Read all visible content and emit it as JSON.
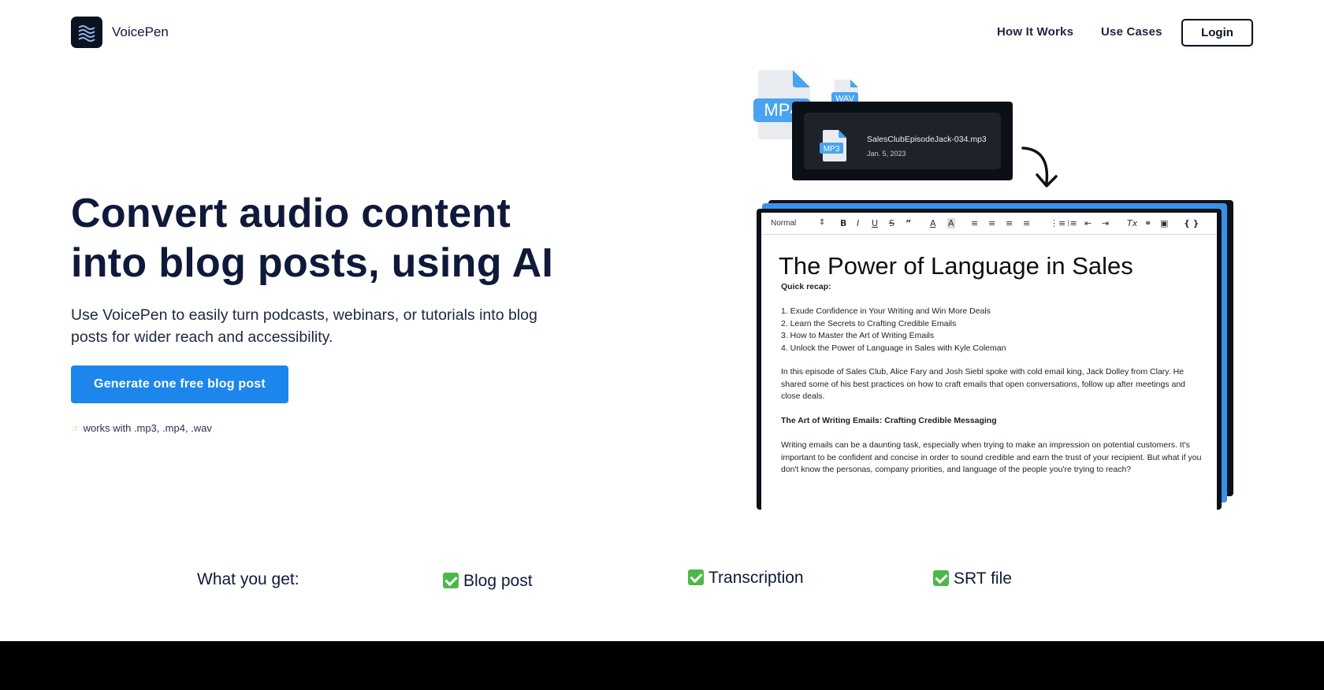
{
  "nav": {
    "brand": "VoicePen",
    "links": [
      "How It Works",
      "Use Cases"
    ],
    "login": "Login"
  },
  "hero": {
    "title": "Convert audio content into blog posts, using AI",
    "subtitle": "Use VoicePen to easily turn podcasts, webinars, or tutorials into blog posts for wider reach and accessibility.",
    "cta": "Generate one free blog post",
    "formats_icon": "pointing-hand-icon",
    "formats": "works with .mp3, .mp4, .wav"
  },
  "illustration": {
    "file_mp4": "MP4",
    "file_wav": "WAV",
    "file_mp3": "MP3",
    "player_filename": "SalesClubEpisodeJack-034.mp3",
    "player_date": "Jan. 5, 2023",
    "toolbar_style": "Normal",
    "doc_title": "The Power of Language in Sales",
    "recap_heading": "Quick recap:",
    "recap_items": [
      "1. Exude Confidence in Your Writing and Win More Deals",
      "2. Learn the Secrets to Crafting Credible Emails",
      "3. How to Master the Art of Writing Emails",
      "4. Unlock the Power of Language in Sales with Kyle Coleman"
    ],
    "intro": "In this episode of Sales Club, Alice Fary and Josh Siebl spoke with cold email king, Jack Dolley from Clary. He shared some of his best practices on how to craft emails that open conversations, follow up after meetings and close deals.",
    "section_heading": "The Art of Writing Emails: Crafting Credible Messaging",
    "section_body": "Writing emails can be a daunting task, especially when trying to make an impression on potential customers. It's important to be confident and concise in order to sound credible and earn the trust of your recipient. But what if you don't know the personas, company priorities, and language of the people you're trying to reach?"
  },
  "benefits": {
    "label": "What you get:",
    "items": [
      "Blog post",
      "Transcription",
      "SRT file"
    ]
  },
  "colors": {
    "primary": "#1c86ec",
    "text": "#0f1a3a",
    "check": "#4cb84a",
    "footer": "#000000"
  }
}
